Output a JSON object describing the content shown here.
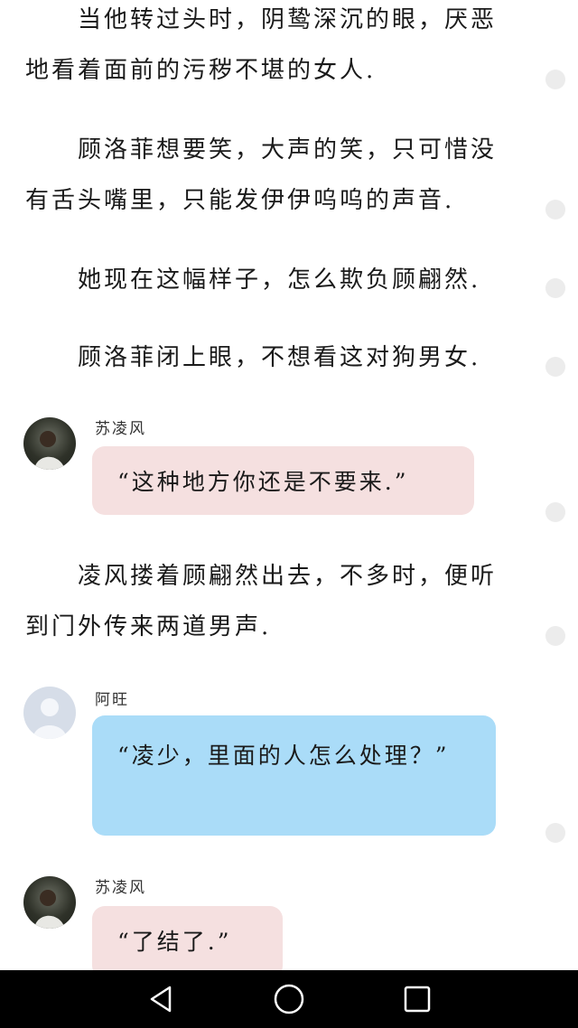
{
  "paragraphs": [
    "　　当他转过头时，阴鸷深沉的眼，厌恶地看着面前的污秽不堪的女人.",
    "　　顾洛菲想要笑，大声的笑，只可惜没有舌头嘴里，只能发伊伊呜呜的声音.",
    "　　她现在这幅样子，怎么欺负顾翩然.",
    "　　顾洛菲闭上眼，不想看这对狗男女.",
    "　　凌风搂着顾翩然出去，不多时，便听到门外传来两道男声."
  ],
  "messages": [
    {
      "speaker": "苏凌风",
      "text": "“这种地方你还是不要来.”",
      "avatar": "photo-avatar",
      "color": "#f5e0e0"
    },
    {
      "speaker": "阿旺",
      "text": "“凌少，里面的人怎么处理？”",
      "avatar": "default-user-avatar",
      "color": "#aadcf8"
    },
    {
      "speaker": "苏凌风",
      "text": "“了结了.”",
      "avatar": "photo-avatar",
      "color": "#f5e0e0"
    }
  ],
  "nav": {
    "back": "back-triangle-icon",
    "home": "home-circle-icon",
    "recents": "recents-square-icon"
  }
}
